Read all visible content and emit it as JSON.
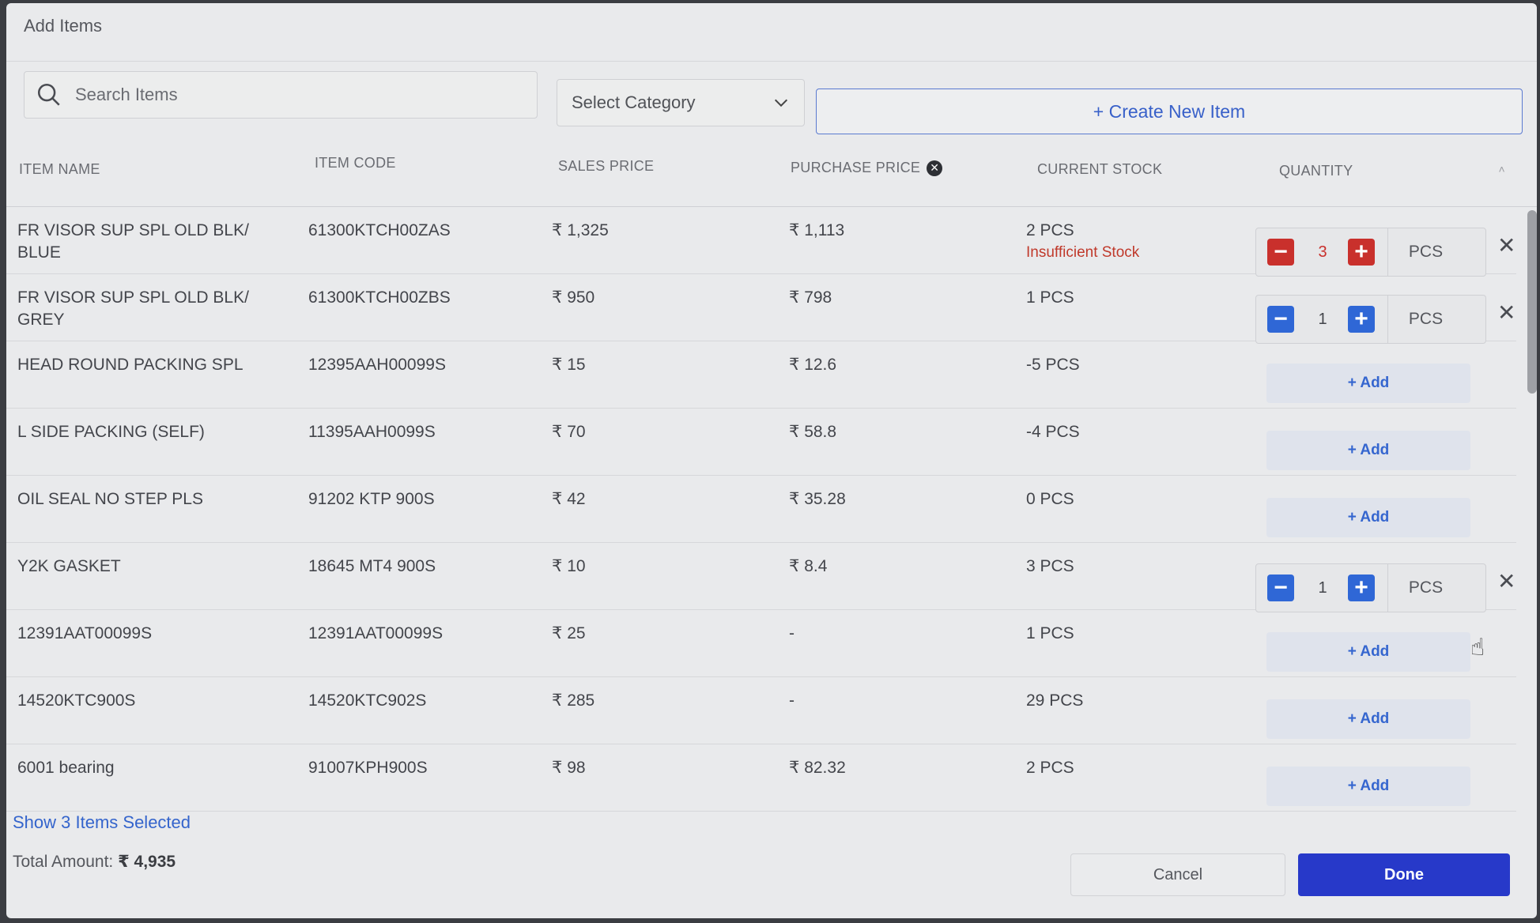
{
  "dialog": {
    "title": "Add Items"
  },
  "search": {
    "placeholder": "Search Items"
  },
  "category": {
    "selected": "Select Category"
  },
  "create_button": "+ Create New Item",
  "columns": {
    "item_name": "ITEM NAME",
    "item_code": "ITEM CODE",
    "sales_price": "SALES PRICE",
    "purchase_price": "PURCHASE PRICE",
    "current_stock": "CURRENT STOCK",
    "quantity": "QUANTITY"
  },
  "rows": [
    {
      "name": "FR VISOR SUP SPL OLD BLK/ BLUE",
      "code": "61300KTCH00ZAS",
      "sales": "₹ 1,325",
      "purchase": "₹ 1,113",
      "stock": "2 PCS",
      "warning": "Insufficient Stock",
      "qty": "3",
      "unit": "PCS",
      "selected": true,
      "error": true
    },
    {
      "name": "FR VISOR SUP SPL OLD BLK/ GREY",
      "code": "61300KTCH00ZBS",
      "sales": "₹ 950",
      "purchase": "₹ 798",
      "stock": "1 PCS",
      "qty": "1",
      "unit": "PCS",
      "selected": true
    },
    {
      "name": "HEAD ROUND PACKING SPL",
      "code": "12395AAH00099S",
      "sales": "₹ 15",
      "purchase": "₹ 12.6",
      "stock": "-5 PCS",
      "add": "+ Add"
    },
    {
      "name": "L SIDE PACKING (SELF)",
      "code": "11395AAH0099S",
      "sales": "₹ 70",
      "purchase": "₹ 58.8",
      "stock": "-4 PCS",
      "add": "+ Add"
    },
    {
      "name": "OIL SEAL NO STEP PLS",
      "code": "91202 KTP 900S",
      "sales": "₹ 42",
      "purchase": "₹ 35.28",
      "stock": "0 PCS",
      "add": "+ Add"
    },
    {
      "name": "Y2K GASKET",
      "code": "18645 MT4 900S",
      "sales": "₹ 10",
      "purchase": "₹ 8.4",
      "stock": "3 PCS",
      "qty": "1",
      "unit": "PCS",
      "selected": true
    },
    {
      "name": "12391AAT00099S",
      "code": "12391AAT00099S",
      "sales": "₹ 25",
      "purchase": "-",
      "stock": "1 PCS",
      "add": "+ Add"
    },
    {
      "name": "14520KTC900S",
      "code": "14520KTC902S",
      "sales": "₹ 285",
      "purchase": "-",
      "stock": "29 PCS",
      "add": "+ Add"
    },
    {
      "name": "6001 bearing",
      "code": "91007KPH900S",
      "sales": "₹ 98",
      "purchase": "₹ 82.32",
      "stock": "2 PCS",
      "add": "+ Add"
    }
  ],
  "footer": {
    "show_selected": "Show 3 Items Selected",
    "total_label": "Total Amount:",
    "total_value": "₹ 4,935",
    "cancel": "Cancel",
    "done": "Done"
  },
  "colors": {
    "accent": "#2739c9",
    "error": "#c9302c",
    "link": "#3464cc"
  },
  "icons": {
    "search": "search-icon",
    "chevron": "chevron-down-icon",
    "remove": "close-icon",
    "minus": "minus-icon",
    "plus": "plus-icon",
    "info": "close-circle-icon"
  }
}
